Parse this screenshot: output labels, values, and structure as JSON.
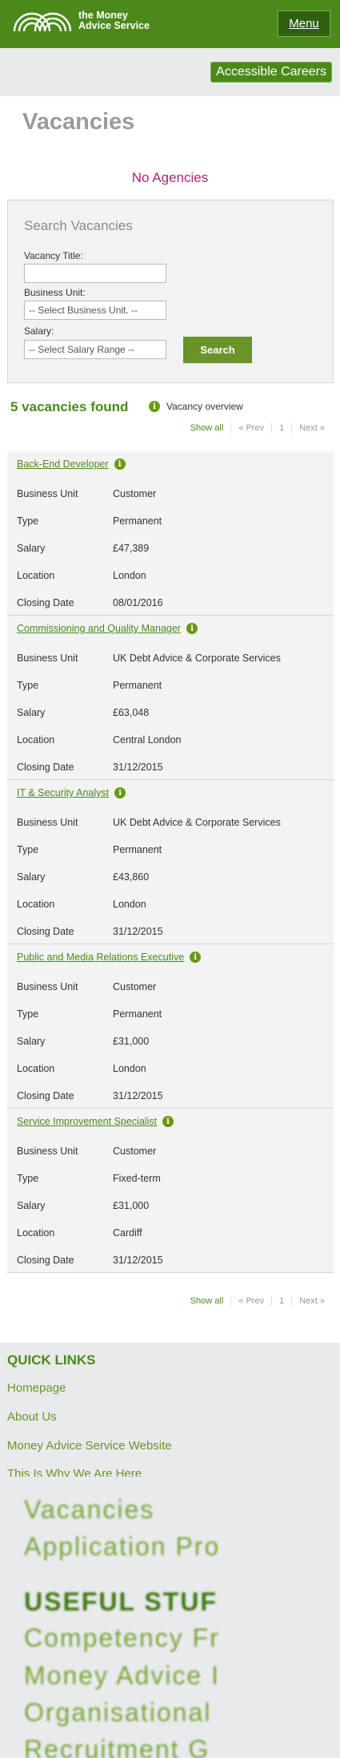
{
  "header": {
    "logo_line1": "the Money",
    "logo_line2": "Advice Service",
    "menu_label": "Menu"
  },
  "band": {
    "careers_label": "Accessible Careers"
  },
  "page": {
    "title": "Vacancies",
    "no_agencies": "No Agencies"
  },
  "search": {
    "title": "Search Vacancies",
    "vacancy_title_label": "Vacancy Title:",
    "vacancy_title_value": "",
    "business_unit_label": "Business Unit:",
    "business_unit_selected": "-- Select Business Unit. --",
    "salary_label": "Salary:",
    "salary_selected": "-- Select Salary Range --",
    "button": "Search"
  },
  "results": {
    "found": "5 vacancies found",
    "overview": "Vacancy overview",
    "pager": {
      "show_all": "Show all",
      "prev": "« Prev",
      "page": "1",
      "next": "Next »"
    }
  },
  "field_labels": {
    "business_unit": "Business Unit",
    "type": "Type",
    "salary": "Salary",
    "location": "Location",
    "closing_date": "Closing Date"
  },
  "vacancies": [
    {
      "title": "Back-End Developer",
      "business_unit": "Customer",
      "type": "Permanent",
      "salary": "£47,389",
      "location": "London",
      "closing_date": "08/01/2016"
    },
    {
      "title": "Commissioning and Quality Manager",
      "business_unit": "UK Debt Advice & Corporate Services",
      "type": "Permanent",
      "salary": "£63,048",
      "location": "Central London",
      "closing_date": "31/12/2015"
    },
    {
      "title": "IT & Security Analyst",
      "business_unit": "UK Debt Advice & Corporate Services",
      "type": "Permanent",
      "salary": "£43,860",
      "location": "London",
      "closing_date": "31/12/2015"
    },
    {
      "title": "Public and Media Relations Executive",
      "business_unit": "Customer",
      "type": "Permanent",
      "salary": "£31,000",
      "location": "London",
      "closing_date": "31/12/2015"
    },
    {
      "title": "Service Improvement Specialist",
      "business_unit": "Customer",
      "type": "Fixed-term",
      "salary": "£31,000",
      "location": "Cardiff",
      "closing_date": "31/12/2015"
    }
  ],
  "footer": {
    "quick_links_title": "QUICK LINKS",
    "quick_links": [
      "Homepage",
      "About Us",
      "Money Advice Service Website",
      "This Is Why We Are Here"
    ],
    "big_links": [
      "Vacancies",
      "Application Pro"
    ],
    "useful_title": "USEFUL STUF",
    "useful_links": [
      "Competency Fr",
      "Money Advice I",
      "Organisational",
      "Recruitment G"
    ]
  },
  "colors": {
    "brand_green": "#4b8a1a",
    "accent_magenta": "#b0217a",
    "band_grey": "#e8eaeb"
  }
}
